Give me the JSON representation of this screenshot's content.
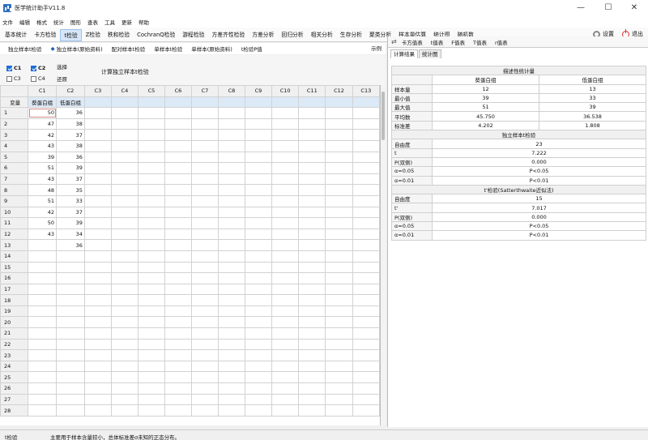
{
  "window": {
    "title": "医学统计助手V11.8",
    "min": "—",
    "max": "☐",
    "close": "✕"
  },
  "menu": [
    "文件",
    "编辑",
    "格式",
    "统计",
    "图形",
    "查表",
    "工具",
    "更新",
    "帮助"
  ],
  "ribbon_tabs": [
    "基本统计",
    "卡方检验",
    "t检验",
    "Z检验",
    "秩和检验",
    "CochranQ检验",
    "游程检验",
    "方差齐性检验",
    "方差分析",
    "回归分析",
    "相关分析",
    "生存分析",
    "聚类分析",
    "样本量估算",
    "统计图",
    "随机数"
  ],
  "ribbon_active": "t检验",
  "ribbon_right": {
    "settings": "设置",
    "exit": "退出"
  },
  "sub_tabs": [
    "独立样本t检验",
    "独立样本(原始资料)",
    "配对样本t检验",
    "单样本t检验",
    "单样本(原始资料)",
    "t检验P值"
  ],
  "example_label": "示例",
  "options": {
    "c1": "C1",
    "c2": "C2",
    "c3": "C3",
    "c4": "C4",
    "select": "选择",
    "restore": "还原",
    "compute": "计算独立样本t检验"
  },
  "grid": {
    "col_headers": [
      "",
      "C1",
      "C2",
      "C3",
      "C4",
      "C5",
      "C6",
      "C7",
      "C8",
      "C9",
      "C10",
      "C11",
      "C12",
      "C13"
    ],
    "var_row": {
      "label": "变量",
      "c1": "葵蛋白组",
      "c2": "低蛋白组"
    },
    "rows": [
      [
        "1",
        "50",
        "36"
      ],
      [
        "2",
        "47",
        "38"
      ],
      [
        "3",
        "42",
        "37"
      ],
      [
        "4",
        "43",
        "38"
      ],
      [
        "5",
        "39",
        "36"
      ],
      [
        "6",
        "51",
        "39"
      ],
      [
        "7",
        "43",
        "37"
      ],
      [
        "8",
        "48",
        "35"
      ],
      [
        "9",
        "51",
        "33"
      ],
      [
        "10",
        "42",
        "37"
      ],
      [
        "11",
        "50",
        "39"
      ],
      [
        "12",
        "43",
        "34"
      ],
      [
        "13",
        "",
        "36"
      ],
      [
        "14",
        "",
        ""
      ],
      [
        "15",
        "",
        ""
      ],
      [
        "16",
        "",
        ""
      ],
      [
        "17",
        "",
        ""
      ],
      [
        "18",
        "",
        ""
      ],
      [
        "19",
        "",
        ""
      ],
      [
        "20",
        "",
        ""
      ],
      [
        "21",
        "",
        ""
      ],
      [
        "22",
        "",
        ""
      ],
      [
        "23",
        "",
        ""
      ],
      [
        "24",
        "",
        ""
      ],
      [
        "25",
        "",
        ""
      ],
      [
        "26",
        "",
        ""
      ],
      [
        "27",
        "",
        ""
      ],
      [
        "28",
        "",
        ""
      ]
    ]
  },
  "right_tabs": [
    "卡方值表",
    "t值表",
    "F值表",
    "T值表",
    "r值表"
  ],
  "result_tabs": [
    "计算结果",
    "统计图"
  ],
  "results": {
    "desc_title": "描述性统计量",
    "groups": [
      "葵蛋白组",
      "低蛋白组"
    ],
    "desc_rows": [
      [
        "样本量",
        "12",
        "13"
      ],
      [
        "最小值",
        "39",
        "33"
      ],
      [
        "最大值",
        "51",
        "39"
      ],
      [
        "平均数",
        "45.750",
        "36.538"
      ],
      [
        "标准差",
        "4.202",
        "1.808"
      ]
    ],
    "t_title": "独立样本t检验",
    "t_rows": [
      [
        "自由度",
        "23"
      ],
      [
        "t",
        "7.222"
      ],
      [
        "P(双侧)",
        "0.000"
      ],
      [
        "α=0.05",
        "P<0.05"
      ],
      [
        "α=0.01",
        "P<0.01"
      ]
    ],
    "tp_title": "t'检验(Satterthwaite近似法)",
    "tp_rows": [
      [
        "自由度",
        "15"
      ],
      [
        "t'",
        "7.017"
      ],
      [
        "P(双侧)",
        "0.000"
      ],
      [
        "α=0.05",
        "P<0.05"
      ],
      [
        "α=0.01",
        "P<0.01"
      ]
    ]
  },
  "status": {
    "left": "t检验",
    "message": "主要用于样本含量较小，总体标准差σ未知的正态分布。"
  }
}
